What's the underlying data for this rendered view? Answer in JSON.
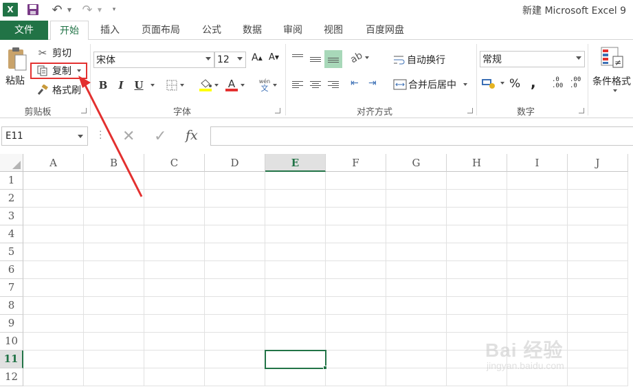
{
  "title_bar": {
    "app_icon_text": "X",
    "title": "新建 Microsoft Excel 9"
  },
  "tabs": [
    {
      "label": "文件",
      "active": false
    },
    {
      "label": "开始",
      "active": true
    },
    {
      "label": "插入",
      "active": false
    },
    {
      "label": "页面布局",
      "active": false
    },
    {
      "label": "公式",
      "active": false
    },
    {
      "label": "数据",
      "active": false
    },
    {
      "label": "审阅",
      "active": false
    },
    {
      "label": "视图",
      "active": false
    },
    {
      "label": "百度网盘",
      "active": false
    }
  ],
  "ribbon": {
    "clipboard": {
      "paste_label": "粘贴",
      "cut_label": "剪切",
      "copy_label": "复制",
      "format_painter_label": "格式刷",
      "group_label": "剪贴板"
    },
    "font": {
      "font_name": "宋体",
      "font_size": "12",
      "bold": "B",
      "italic": "I",
      "underline": "U",
      "grow": "A",
      "shrink": "A",
      "font_color_glyph": "A",
      "phonetic_top": "wén",
      "phonetic_bottom": "文",
      "group_label": "字体",
      "fill_color": "#ffff00",
      "font_color": "#e3302f"
    },
    "alignment": {
      "wrap_text_label": "自动换行",
      "merge_center_label": "合并后居中",
      "group_label": "对齐方式"
    },
    "number": {
      "format": "常规",
      "percent": "%",
      "comma": ",",
      "increase_decimal": ".0\n.00",
      "decrease_decimal": ".00\n.0",
      "group_label": "数字"
    },
    "styles": {
      "conditional_format_label": "条件格式"
    }
  },
  "formula_bar": {
    "name_box": "E11",
    "fx": "fx",
    "formula": ""
  },
  "sheet": {
    "columns": [
      "A",
      "B",
      "C",
      "D",
      "E",
      "F",
      "G",
      "H",
      "I",
      "J"
    ],
    "rows": [
      "1",
      "2",
      "3",
      "4",
      "5",
      "6",
      "7",
      "8",
      "9",
      "10",
      "11",
      "12"
    ],
    "selected_column": "E",
    "selected_row": "11",
    "accent": "#217346"
  },
  "watermark": {
    "brand": "Bai 经验",
    "url": "jingyan.baidu.com"
  }
}
